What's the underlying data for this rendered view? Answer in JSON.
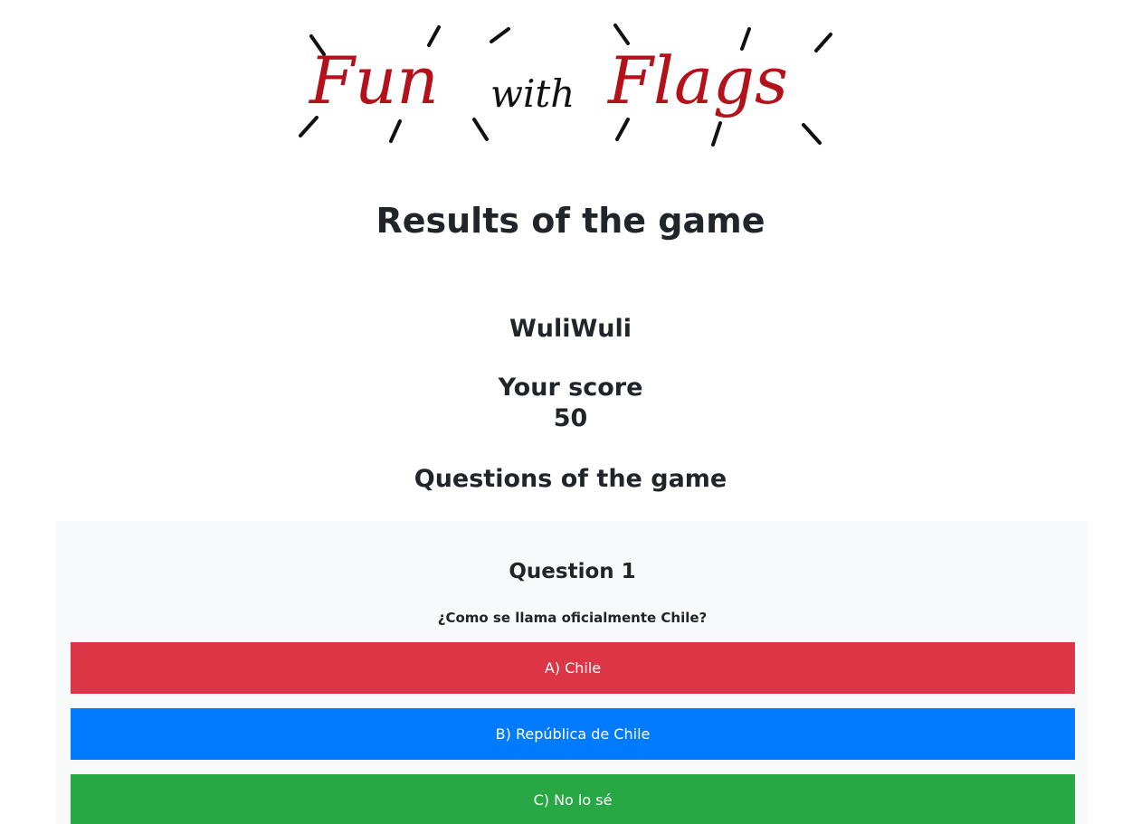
{
  "logo": {
    "text_fun": "Fun",
    "text_with": "with",
    "text_flags": "Flags"
  },
  "header": {
    "title": "Results of the game"
  },
  "player": {
    "name": "WuliWuli",
    "score_label": "Your score",
    "score_value": "50"
  },
  "questions": {
    "heading": "Questions of the game",
    "items": [
      {
        "title": "Question 1",
        "text": "¿Como se llama oficialmente Chile?",
        "answers": [
          {
            "label": "A) Chile",
            "color": "#dc3545"
          },
          {
            "label": "B) República de Chile",
            "color": "#007bff"
          },
          {
            "label": "C) No lo sé",
            "color": "#28a745"
          }
        ]
      }
    ]
  },
  "colors": {
    "logo_red": "#b3121b",
    "logo_black": "#111111"
  }
}
